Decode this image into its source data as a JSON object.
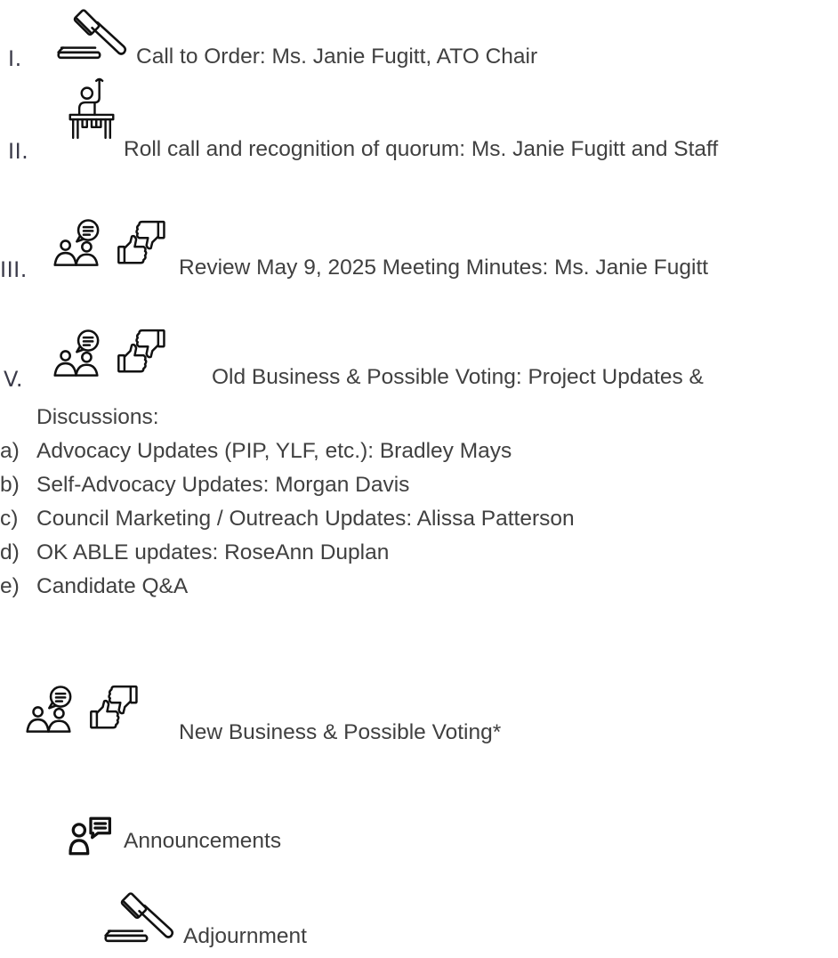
{
  "agenda": {
    "item1": {
      "numeral": "I.",
      "text": "Call to Order: Ms. Janie Fugitt, ATO Chair",
      "icon": "gavel-icon"
    },
    "item2": {
      "numeral": "II.",
      "text": "Roll call and recognition of quorum: Ms. Janie Fugitt and Staff",
      "icon": "roll-call-icon"
    },
    "item3": {
      "numeral": "III.",
      "text": "Review May 9, 2025 Meeting Minutes: Ms. Janie Fugitt",
      "icon": "discussion-vote-icon"
    },
    "item4": {
      "numeral": "V.",
      "text_line1": "Old Business & Possible Voting: Project Updates &",
      "text_line2": "Discussions:",
      "icon": "discussion-vote-icon",
      "subitems": [
        {
          "marker": "a)",
          "text": "Advocacy Updates (PIP, YLF, etc.): Bradley Mays"
        },
        {
          "marker": "b)",
          "text": "Self-Advocacy Updates: Morgan Davis"
        },
        {
          "marker": "c)",
          "text": "Council Marketing / Outreach Updates: Alissa Patterson"
        },
        {
          "marker": "d)",
          "text": "OK ABLE updates: RoseAnn Duplan"
        },
        {
          "marker": "e)",
          "text": "Candidate Q&A"
        }
      ]
    },
    "item5": {
      "text": "New Business & Possible Voting*",
      "icon": "discussion-vote-icon"
    },
    "item6": {
      "text": "Announcements",
      "icon": "announcement-icon"
    },
    "item7": {
      "text": "Adjournment",
      "icon": "gavel-icon"
    }
  }
}
